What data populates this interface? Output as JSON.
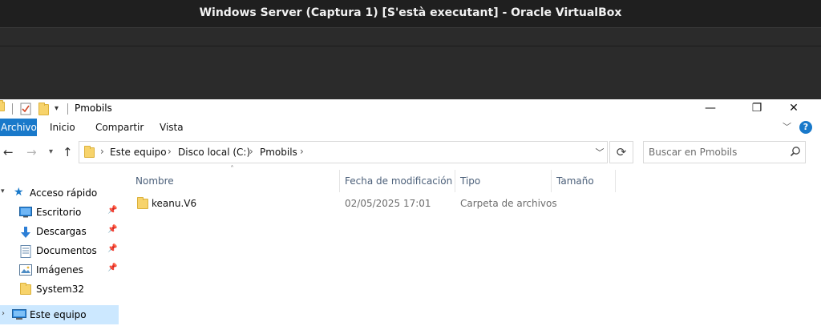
{
  "vbox": {
    "title": "Windows Server (Captura 1) [S'està executant] - Oracle VirtualBox"
  },
  "explorer": {
    "window_title": "Pmobils",
    "window_controls": {
      "minimize": "—",
      "maximize": "❐",
      "close": "✕"
    },
    "ribbon": {
      "file_tab": "Archivo",
      "tabs": [
        "Inicio",
        "Compartir",
        "Vista"
      ],
      "help": "?"
    },
    "address": {
      "segments": [
        "Este equipo",
        "Disco local (C:)",
        "Pmobils"
      ],
      "separator": "›"
    },
    "search": {
      "placeholder": "Buscar en Pmobils"
    },
    "nav": {
      "quick_access": "Acceso rápido",
      "items": [
        {
          "label": "Escritorio",
          "icon": "desktop-icon",
          "pinned": true
        },
        {
          "label": "Descargas",
          "icon": "download-icon",
          "pinned": true
        },
        {
          "label": "Documentos",
          "icon": "document-icon",
          "pinned": true
        },
        {
          "label": "Imágenes",
          "icon": "pictures-icon",
          "pinned": true
        },
        {
          "label": "System32",
          "icon": "folder-icon",
          "pinned": false
        }
      ],
      "this_pc": "Este equipo"
    },
    "columns": [
      "Nombre",
      "Fecha de modificación",
      "Tipo",
      "Tamaño"
    ],
    "files": [
      {
        "name": "keanu.V6",
        "modified": "02/05/2025 17:01",
        "type": "Carpeta de archivos",
        "size": ""
      }
    ]
  },
  "colors": {
    "accent": "#1979ca",
    "selection": "#cce8ff",
    "folder": "#f7d36b"
  }
}
